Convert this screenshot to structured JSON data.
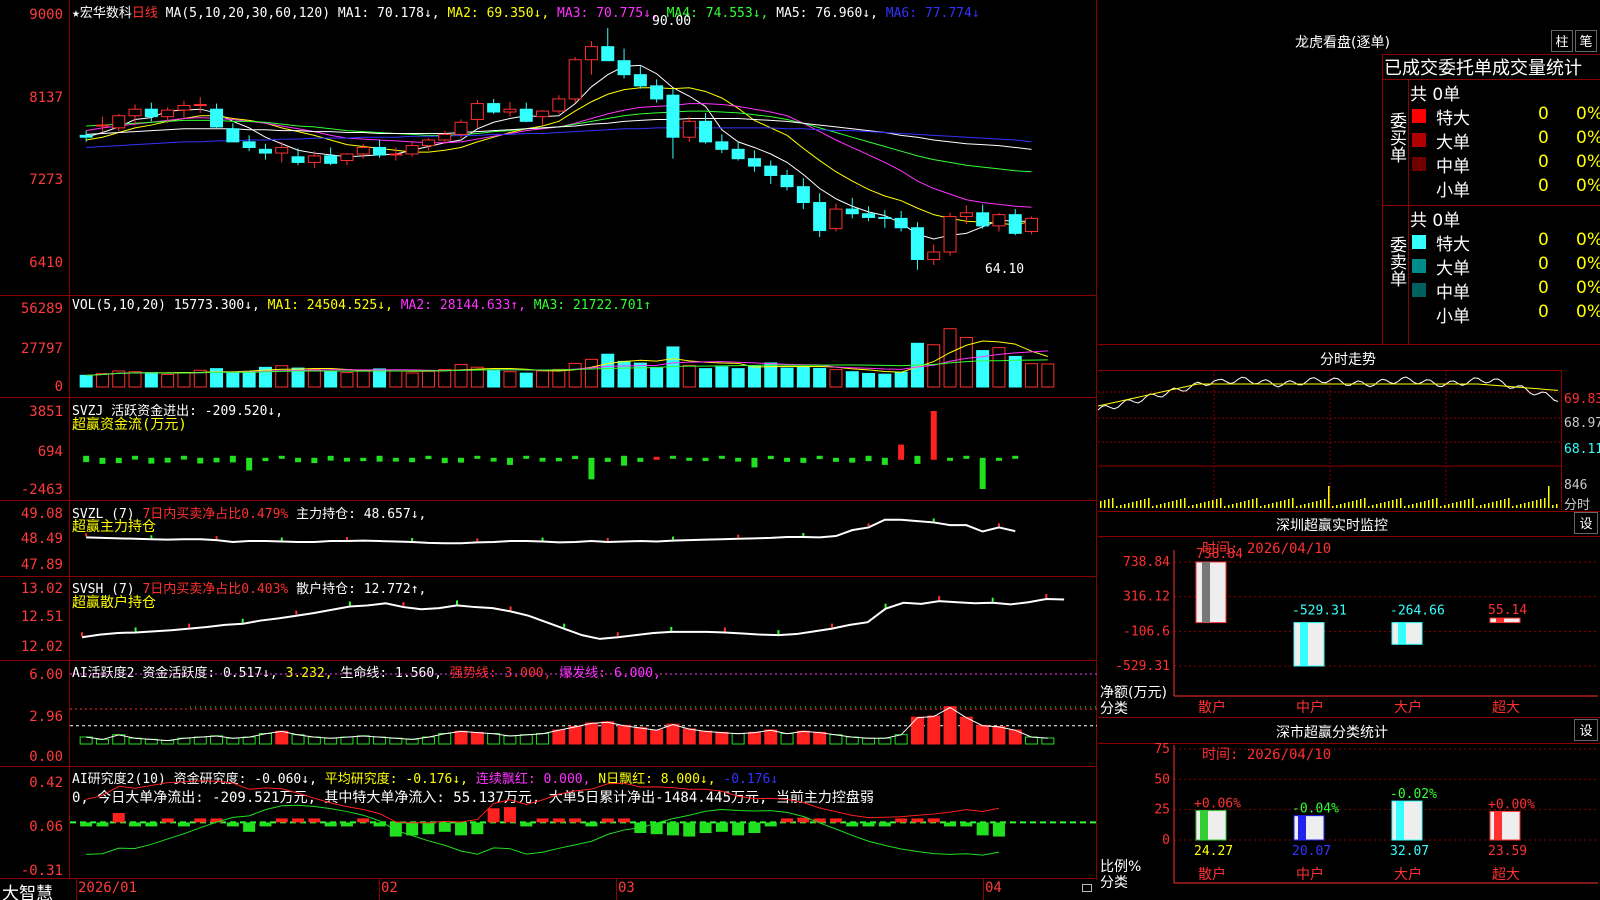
{
  "main": {
    "stock": "★宏华数科",
    "period": "日线",
    "ma_header": "MA(5,10,20,30,60,120)",
    "ma": [
      {
        "label": "MA1: 70.178↓,",
        "color": "#ffffff"
      },
      {
        "label": "MA2: 69.350↓,",
        "color": "#ffff00"
      },
      {
        "label": "MA3: 70.775↓,",
        "color": "#ff33ff"
      },
      {
        "label": "MA4: 74.553↓,",
        "color": "#33ff33"
      },
      {
        "label": "MA5: 76.960↓,",
        "color": "#ffffff"
      },
      {
        "label": "MA6: 77.774↓",
        "color": "#3333ff"
      }
    ],
    "yticks": [
      "9000",
      "8137",
      "7273",
      "6410"
    ],
    "high_label": "90.00",
    "low_label": "64.10"
  },
  "vol": {
    "header": "VOL(5,10,20)",
    "value": "15773.300↓,",
    "ma1": "MA1: 24504.525↓,",
    "ma2": "MA2: 28144.633↑,",
    "ma3": "MA3: 21722.701↑",
    "yticks": [
      "56289",
      "27797",
      "0"
    ]
  },
  "svzj": {
    "header": "SVZJ",
    "label": "活跃资金进出: -209.520↓,",
    "sub": "超赢资金流(万元)",
    "yticks": [
      "3851",
      "694",
      "-2463"
    ]
  },
  "svzl": {
    "header": "SVZL (7)",
    "label1": "7日内买卖净占比0.479%",
    "label2": "主力持仓: 48.657↓,",
    "sub": "超赢主力持仓",
    "yticks": [
      "49.08",
      "48.49",
      "47.89"
    ]
  },
  "svsh": {
    "header": "SVSH (7)",
    "label1": "7日内买卖净占比0.403%",
    "label2": "散户持仓: 12.772↑,",
    "sub": "超赢散户持仓",
    "yticks": [
      "13.02",
      "12.51",
      "12.02"
    ]
  },
  "ai1": {
    "header": "AI活跃度2",
    "label1": "资金活跃度: 0.517↓,",
    "label2": "3.232,",
    "label3": "生命线: 1.560,",
    "label4": "强势线: 3.000,",
    "label5": "爆发线: 6.000,",
    "yticks": [
      "6.00",
      "2.96",
      "0.00"
    ]
  },
  "ai2": {
    "header": "AI研究度2(10)",
    "label1": "资金研究度: -0.060↓,",
    "label2": "平均研究度: -0.176↓,",
    "label3": "连续飘红: 0.000,",
    "label4": "N日飘红: 8.000↓,",
    "label5": "-0.176↓",
    "note": "0, 今日大单净流出: -209.521万元, 其中特大单净流入: 55.137万元, 大单5日累计净出-1484.445万元, 当前主力控盘弱",
    "yticks": [
      "0.42",
      "0.06",
      "-0.31"
    ]
  },
  "xaxis": {
    "brand": "大智慧",
    "labels": [
      "2026/01",
      "02",
      "03",
      "04"
    ]
  },
  "dragon": {
    "title": "龙虎看盘(逐单)",
    "btn1": "柱",
    "btn2": "笔",
    "subtitle": "已成交委托单成交量统计",
    "buy_total": "共 0单",
    "buy_side": "委买单",
    "sell_total": "共 0单",
    "sell_side": "委卖单",
    "buy_rows": [
      {
        "label": "特大",
        "count": "0",
        "pct": "0%",
        "color": "#ff0000"
      },
      {
        "label": "大单",
        "count": "0",
        "pct": "0%",
        "color": "#b00000"
      },
      {
        "label": "中单",
        "count": "0",
        "pct": "0%",
        "color": "#700000"
      },
      {
        "label": "小单",
        "count": "0",
        "pct": "0%",
        "color": "#000000"
      }
    ],
    "sell_rows": [
      {
        "label": "特大",
        "count": "0",
        "pct": "0%",
        "color": "#33ffff"
      },
      {
        "label": "大单",
        "count": "0",
        "pct": "0%",
        "color": "#008b8b"
      },
      {
        "label": "中单",
        "count": "0",
        "pct": "0%",
        "color": "#006060"
      },
      {
        "label": "小单",
        "count": "0",
        "pct": "0%",
        "color": "#000000"
      }
    ]
  },
  "intraday": {
    "title": "分时走势",
    "yticks": [
      "69.83",
      "68.97",
      "68.11"
    ],
    "vol_label": "846",
    "vol_unit": "分时"
  },
  "monitor": {
    "title": "深圳超赢实时监控",
    "btn": "设",
    "time": "时间: 2026/04/10",
    "unit": "净额(万元)",
    "category": "分类",
    "yticks": [
      "738.84",
      "316.12",
      "-106.6",
      "-529.31"
    ],
    "bars": [
      {
        "label": "散户",
        "value_text": "738.84",
        "value": 738.84
      },
      {
        "label": "中户",
        "value_text": "-529.31",
        "value": -529.31
      },
      {
        "label": "大户",
        "value_text": "-264.66",
        "value": -264.66
      },
      {
        "label": "超大",
        "value_text": "55.14",
        "value": 55.14
      }
    ]
  },
  "classify": {
    "title": "深市超赢分类统计",
    "btn": "设",
    "time": "时间: 2026/04/10",
    "unit": "比例%",
    "category": "分类",
    "yticks": [
      "75",
      "50",
      "25",
      "0"
    ],
    "bars": [
      {
        "label": "散户",
        "change": "+0.06%",
        "value_text": "24.27",
        "value": 24.27
      },
      {
        "label": "中户",
        "change": "-0.04%",
        "value_text": "20.07",
        "value": 20.07
      },
      {
        "label": "大户",
        "change": "-0.02%",
        "value_text": "32.07",
        "value": 32.07
      },
      {
        "label": "超大",
        "change": "+0.00%",
        "value_text": "23.59",
        "value": 23.59
      }
    ]
  },
  "chart_data": {
    "type": "candlestick",
    "x_labels": [
      "2026/01",
      "02",
      "03",
      "04"
    ],
    "ylim": [
      64.1,
      90.0
    ],
    "candles": [
      [
        78.5,
        79.0,
        77.8,
        78.3
      ],
      [
        79.5,
        80.5,
        78.8,
        79.6
      ],
      [
        79.3,
        80.8,
        78.9,
        80.6
      ],
      [
        80.6,
        81.8,
        79.6,
        81.3
      ],
      [
        81.3,
        82.0,
        80.0,
        80.5
      ],
      [
        80.5,
        81.5,
        79.8,
        81.2
      ],
      [
        81.2,
        82.2,
        80.4,
        81.7
      ],
      [
        81.7,
        82.6,
        80.9,
        81.8
      ],
      [
        81.3,
        81.9,
        79.3,
        79.4
      ],
      [
        79.2,
        79.8,
        77.9,
        77.8
      ],
      [
        77.8,
        78.5,
        76.8,
        77.2
      ],
      [
        77.0,
        77.6,
        75.9,
        76.6
      ],
      [
        76.6,
        77.8,
        75.6,
        77.2
      ],
      [
        76.2,
        77.1,
        75.3,
        75.6
      ],
      [
        75.6,
        76.8,
        75.0,
        76.3
      ],
      [
        76.3,
        77.2,
        75.3,
        75.5
      ],
      [
        75.8,
        76.6,
        75.3,
        76.5
      ],
      [
        76.5,
        77.6,
        76.0,
        77.2
      ],
      [
        77.2,
        78.0,
        76.1,
        76.4
      ],
      [
        76.4,
        77.2,
        75.8,
        76.5
      ],
      [
        76.5,
        77.9,
        76.2,
        77.4
      ],
      [
        77.4,
        78.2,
        76.9,
        78.0
      ],
      [
        78.0,
        79.0,
        77.6,
        78.6
      ],
      [
        78.6,
        80.2,
        78.2,
        79.9
      ],
      [
        80.2,
        82.3,
        79.3,
        81.9
      ],
      [
        81.9,
        82.4,
        80.8,
        81.0
      ],
      [
        81.0,
        82.1,
        80.5,
        81.3
      ],
      [
        81.3,
        82.0,
        79.9,
        80.0
      ],
      [
        80.5,
        81.2,
        79.6,
        81.1
      ],
      [
        81.1,
        82.8,
        80.8,
        82.4
      ],
      [
        82.4,
        86.9,
        82.0,
        86.6
      ],
      [
        86.6,
        88.6,
        85.0,
        88.0
      ],
      [
        88.0,
        90.0,
        86.5,
        86.5
      ],
      [
        86.5,
        87.8,
        84.6,
        85.0
      ],
      [
        85.0,
        85.9,
        83.5,
        83.8
      ],
      [
        83.8,
        84.5,
        82.0,
        82.4
      ],
      [
        82.8,
        83.5,
        76.0,
        78.3
      ],
      [
        78.3,
        80.5,
        77.8,
        80.0
      ],
      [
        80.0,
        80.9,
        77.6,
        77.8
      ],
      [
        77.8,
        78.6,
        76.6,
        77.0
      ],
      [
        77.0,
        77.8,
        75.8,
        76.0
      ],
      [
        76.0,
        76.9,
        74.6,
        75.2
      ],
      [
        75.2,
        75.8,
        73.3,
        74.2
      ],
      [
        74.2,
        74.8,
        72.6,
        73.0
      ],
      [
        73.0,
        73.9,
        70.6,
        71.3
      ],
      [
        71.3,
        72.3,
        67.6,
        68.3
      ],
      [
        68.5,
        71.2,
        68.2,
        70.6
      ],
      [
        70.6,
        71.8,
        69.6,
        70.1
      ],
      [
        70.1,
        70.9,
        69.3,
        69.7
      ],
      [
        69.7,
        70.5,
        68.6,
        69.6
      ],
      [
        69.6,
        70.4,
        68.2,
        68.6
      ],
      [
        68.6,
        69.2,
        64.1,
        65.2
      ],
      [
        65.2,
        66.8,
        64.6,
        66.0
      ],
      [
        66.0,
        70.2,
        65.6,
        69.8
      ],
      [
        69.8,
        71.0,
        69.0,
        70.2
      ],
      [
        70.2,
        71.1,
        68.5,
        68.8
      ],
      [
        68.8,
        70.2,
        68.2,
        70.0
      ],
      [
        70.0,
        70.6,
        67.8,
        68.0
      ],
      [
        68.2,
        69.8,
        67.9,
        69.6
      ]
    ],
    "ma_lines": [
      {
        "name": "MA1",
        "color": "#ffffff",
        "values": [
          78.3,
          78.8,
          79.4,
          80.2,
          80.4,
          81.1,
          81.2,
          81.3,
          80.9,
          80.0,
          79.3,
          78.3,
          77.6,
          76.9,
          76.6,
          76.4,
          76.2,
          76.3,
          76.4,
          76.5,
          76.9,
          77.3,
          77.7,
          78.0,
          79.2,
          79.9,
          80.3,
          80.6,
          80.5,
          80.6,
          81.9,
          83.7,
          85.0,
          85.9,
          86.0,
          85.1,
          83.6,
          82.7,
          81.6,
          79.1,
          77.8,
          77.2,
          76.5,
          75.6,
          74.3,
          72.8,
          71.7,
          70.9,
          70.3,
          69.9,
          69.1,
          67.9,
          67.4,
          67.8,
          68.0,
          68.7,
          69.4,
          69.3,
          69.3
        ]
      },
      {
        "name": "MA2",
        "color": "#ffff00",
        "values": [
          78.0,
          78.3,
          78.8,
          79.3,
          79.6,
          80.0,
          80.3,
          80.6,
          80.6,
          80.3,
          80.1,
          79.8,
          79.3,
          78.9,
          78.5,
          78.0,
          77.5,
          77.3,
          77.1,
          76.9,
          76.7,
          76.7,
          76.9,
          77.2,
          77.8,
          78.3,
          78.8,
          79.2,
          79.5,
          80.0,
          81.1,
          82.1,
          82.9,
          83.4,
          83.6,
          83.6,
          83.5,
          83.6,
          83.2,
          82.5,
          81.4,
          80.1,
          79.3,
          78.5,
          77.1,
          75.8,
          74.6,
          73.6,
          72.7,
          72.0,
          71.5,
          70.7,
          70.0,
          69.6,
          69.3,
          69.2,
          69.1,
          68.9,
          69.3
        ]
      },
      {
        "name": "MA3",
        "color": "#ff33ff",
        "values": [
          79.0,
          79.3,
          79.5,
          79.7,
          79.9,
          80.1,
          80.3,
          80.4,
          80.3,
          80.2,
          80.0,
          79.8,
          79.5,
          79.2,
          78.9,
          78.5,
          78.2,
          78.1,
          78.0,
          77.9,
          77.8,
          77.7,
          77.7,
          77.8,
          78.1,
          78.4,
          78.7,
          79.0,
          79.2,
          79.4,
          79.8,
          80.3,
          80.8,
          81.2,
          81.5,
          81.6,
          81.7,
          81.9,
          81.9,
          81.8,
          81.6,
          81.3,
          81.0,
          80.6,
          79.8,
          78.9,
          78.0,
          77.2,
          76.4,
          75.6,
          74.7,
          73.6,
          72.8,
          72.2,
          71.6,
          71.3,
          71.1,
          70.9,
          70.8
        ]
      },
      {
        "name": "MA4",
        "color": "#33ff33",
        "values": [
          79.5,
          79.6,
          79.7,
          79.8,
          79.9,
          80.0,
          80.1,
          80.1,
          80.1,
          80.0,
          80.0,
          79.9,
          79.7,
          79.5,
          79.4,
          79.2,
          79.0,
          78.9,
          78.8,
          78.7,
          78.6,
          78.5,
          78.5,
          78.6,
          78.7,
          78.9,
          79.0,
          79.2,
          79.3,
          79.4,
          79.7,
          80.0,
          80.3,
          80.6,
          80.8,
          80.9,
          81.0,
          81.1,
          81.1,
          81.0,
          80.9,
          80.7,
          80.5,
          80.2,
          79.8,
          79.3,
          78.8,
          78.3,
          77.8,
          77.3,
          76.8,
          76.3,
          75.9,
          75.6,
          75.3,
          75.1,
          74.9,
          74.7,
          74.6
        ]
      },
      {
        "name": "MA5",
        "color": "#ffffff",
        "values": [
          78.6,
          78.7,
          78.8,
          78.9,
          79.0,
          79.1,
          79.2,
          79.2,
          79.2,
          79.2,
          79.1,
          79.1,
          79.0,
          79.0,
          78.9,
          78.9,
          78.8,
          78.8,
          78.7,
          78.7,
          78.7,
          78.7,
          78.7,
          78.8,
          78.9,
          79.0,
          79.1,
          79.2,
          79.3,
          79.4,
          79.5,
          79.7,
          79.8,
          80.0,
          80.1,
          80.2,
          80.2,
          80.3,
          80.3,
          80.3,
          80.3,
          80.2,
          80.1,
          80.0,
          79.8,
          79.6,
          79.4,
          79.2,
          79.0,
          78.8,
          78.5,
          78.3,
          78.0,
          77.8,
          77.6,
          77.5,
          77.4,
          77.2,
          77.0
        ]
      },
      {
        "name": "MA6",
        "color": "#3333ff",
        "values": [
          77.2,
          77.3,
          77.4,
          77.5,
          77.6,
          77.7,
          77.8,
          77.8,
          77.9,
          77.9,
          78.0,
          78.0,
          78.1,
          78.1,
          78.2,
          78.2,
          78.2,
          78.3,
          78.3,
          78.3,
          78.4,
          78.4,
          78.4,
          78.5,
          78.5,
          78.6,
          78.6,
          78.7,
          78.7,
          78.8,
          78.9,
          79.0,
          79.1,
          79.2,
          79.2,
          79.3,
          79.3,
          79.3,
          79.3,
          79.3,
          79.3,
          79.3,
          79.3,
          79.2,
          79.2,
          79.1,
          79.0,
          79.0,
          78.9,
          78.8,
          78.7,
          78.6,
          78.5,
          78.4,
          78.3,
          78.2,
          78.1,
          78.0,
          77.8
        ]
      }
    ],
    "volume": [
      8000,
      9200,
      11000,
      10500,
      9800,
      8600,
      9900,
      11500,
      12600,
      9800,
      10500,
      13500,
      14600,
      13000,
      12000,
      10600,
      9900,
      11300,
      12400,
      11000,
      9600,
      10800,
      12000,
      15400,
      13600,
      11800,
      10500,
      9500,
      11000,
      12100,
      16200,
      19000,
      22500,
      17600,
      16400,
      13500,
      27500,
      14800,
      12600,
      13800,
      12600,
      14300,
      16500,
      13000,
      14100,
      12800,
      11900,
      10500,
      9300,
      8800,
      10200,
      30000,
      29000,
      40000,
      34000,
      25000,
      27000,
      21000,
      16000,
      15773
    ],
    "svzj": [
      -500,
      -480,
      -420,
      -300,
      -460,
      -380,
      -300,
      -450,
      -360,
      -520,
      -1000,
      -260,
      -200,
      -350,
      -420,
      -380,
      -300,
      -260,
      -460,
      -300,
      -350,
      -260,
      -420,
      -380,
      -220,
      -300,
      -560,
      -220,
      -300,
      -280,
      -260,
      -1700,
      -320,
      -780,
      -320,
      200,
      -120,
      -200,
      -260,
      -100,
      -300,
      -760,
      -260,
      -320,
      -400,
      -260,
      -320,
      -380,
      -420,
      -560,
      1200,
      -640,
      3851,
      -180,
      -100,
      -2463,
      -200,
      -209.5
    ],
    "svzl": [
      48.52,
      48.51,
      48.5,
      48.49,
      48.48,
      48.47,
      48.48,
      48.48,
      48.46,
      48.42,
      48.44,
      48.44,
      48.43,
      48.42,
      48.42,
      48.44,
      48.44,
      48.45,
      48.44,
      48.43,
      48.42,
      48.4,
      48.39,
      48.39,
      48.41,
      48.42,
      48.44,
      48.44,
      48.43,
      48.41,
      48.42,
      48.44,
      48.42,
      48.43,
      48.44,
      48.43,
      48.45,
      48.46,
      48.47,
      48.48,
      48.49,
      48.5,
      48.51,
      48.53,
      48.53,
      48.52,
      48.55,
      48.68,
      48.74,
      48.91,
      48.91,
      48.88,
      48.85,
      48.79,
      48.79,
      48.65,
      48.74,
      48.657
    ],
    "svsh": [
      12.07,
      12.12,
      12.15,
      12.16,
      12.18,
      12.2,
      12.23,
      12.26,
      12.3,
      12.32,
      12.38,
      12.42,
      12.47,
      12.52,
      12.58,
      12.64,
      12.66,
      12.7,
      12.63,
      12.59,
      12.61,
      12.66,
      12.63,
      12.61,
      12.55,
      12.47,
      12.35,
      12.23,
      12.11,
      12.04,
      12.07,
      12.11,
      12.15,
      12.17,
      12.17,
      12.17,
      12.16,
      12.14,
      12.12,
      12.11,
      12.13,
      12.18,
      12.23,
      12.3,
      12.35,
      12.6,
      12.71,
      12.69,
      12.74,
      12.72,
      12.7,
      12.71,
      12.68,
      12.72,
      12.78,
      12.77
    ],
    "ai1_vol": [
      0.6,
      0.4,
      0.8,
      0.5,
      0.4,
      0.3,
      0.5,
      0.6,
      0.7,
      0.5,
      0.6,
      0.9,
      1.1,
      0.8,
      0.6,
      0.5,
      0.6,
      0.7,
      0.6,
      0.5,
      0.4,
      0.6,
      0.9,
      1.1,
      1.0,
      0.9,
      0.7,
      0.8,
      0.9,
      1.2,
      1.5,
      1.8,
      1.9,
      1.6,
      1.4,
      1.2,
      1.7,
      1.3,
      1.1,
      1.0,
      0.9,
      1.0,
      1.2,
      0.9,
      1.1,
      1.0,
      0.8,
      0.6,
      0.5,
      0.5,
      0.8,
      2.3,
      2.4,
      3.2,
      2.3,
      1.6,
      1.5,
      1.2,
      0.6,
      0.517
    ],
    "ai2_bars": [
      0.05,
      0.05,
      0.14,
      0.05,
      0.05,
      0.06,
      0.05,
      0.06,
      0.06,
      0.05,
      -0.02,
      0.05,
      0.09,
      0.08,
      0.06,
      0.05,
      0.05,
      0.06,
      0.04,
      -0.06,
      -0.05,
      -0.04,
      -0.02,
      -0.05,
      -0.04,
      0.18,
      0.19,
      0.05,
      0.06,
      0.09,
      0.08,
      0.05,
      0.09,
      0.06,
      -0.03,
      -0.04,
      -0.05,
      -0.06,
      -0.03,
      -0.02,
      -0.05,
      -0.03,
      0.04,
      0.09,
      0.1,
      0.07,
      0.06,
      0.04,
      0.03,
      0.05,
      0.06,
      0.07,
      0.06,
      0.05,
      0.04,
      -0.05,
      -0.06
    ]
  }
}
